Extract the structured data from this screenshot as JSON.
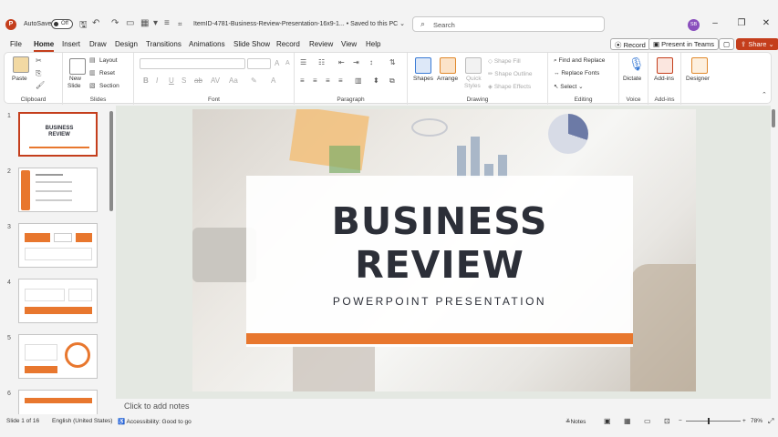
{
  "titlebar": {
    "autosave_label": "AutoSave",
    "autosave_state": "Off",
    "document_title": "ItemID-4781-Business-Review-Presentation-16x9-1...",
    "saved_status": "• Saved to this PC ⌄",
    "search_placeholder": "Search",
    "avatar_initials": "SB"
  },
  "menu": {
    "items": [
      "File",
      "Home",
      "Insert",
      "Draw",
      "Design",
      "Transitions",
      "Animations",
      "Slide Show",
      "Record",
      "Review",
      "View",
      "Help"
    ],
    "active": "Home",
    "record_label": "Record",
    "present_label": "Present in Teams",
    "share_label": "Share"
  },
  "ribbon": {
    "clipboard": {
      "paste": "Paste",
      "label": "Clipboard"
    },
    "slides": {
      "new_slide": "New",
      "new_slide2": "Slide",
      "layout": "Layout",
      "reset": "Reset",
      "section": "Section",
      "label": "Slides"
    },
    "font": {
      "label": "Font"
    },
    "paragraph": {
      "label": "Paragraph"
    },
    "drawing": {
      "shapes": "Shapes",
      "arrange": "Arrange",
      "quick_styles": "Quick",
      "quick_styles2": "Styles",
      "shape_fill": "Shape Fill",
      "shape_outline": "Shape Outline",
      "shape_effects": "Shape Effects",
      "label": "Drawing"
    },
    "editing": {
      "find_replace": "Find and Replace",
      "replace_fonts": "Replace Fonts",
      "select": "Select",
      "label": "Editing"
    },
    "voice": {
      "dictate": "Dictate",
      "label": "Voice"
    },
    "addins": {
      "addins": "Add-ins",
      "label": "Add-ins"
    },
    "designer": {
      "designer": "Designer"
    }
  },
  "thumbnails": {
    "numbers": [
      "1",
      "2",
      "3",
      "4",
      "5",
      "6"
    ],
    "slide1_title1": "BUSINESS",
    "slide1_title2": "REVIEW"
  },
  "slide": {
    "title_line1": "BUSINESS",
    "title_line2": "REVIEW",
    "subtitle": "POWERPOINT PRESENTATION",
    "accent_color": "#e8772e"
  },
  "notes_placeholder": "Click to add notes",
  "status": {
    "slide_count": "Slide 1 of 16",
    "language": "English (United States)",
    "accessibility": "Accessibility: Good to go",
    "notes": "Notes",
    "zoom": "78%"
  }
}
